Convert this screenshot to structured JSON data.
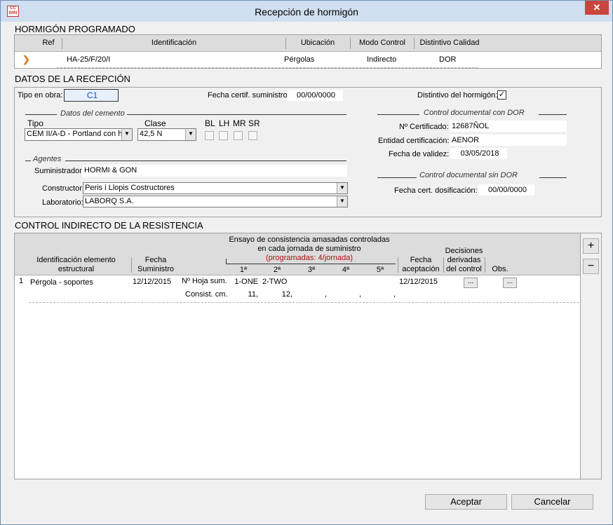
{
  "window": {
    "title": "Recepción de hormigón",
    "app_icon_text": "CC WIN",
    "close_label": "✕"
  },
  "programado": {
    "section_title": "HORMIGÓN PROGRAMADO",
    "columns": [
      "Ref",
      "Identificación",
      "Ubicación",
      "Modo Control",
      "Distintivo Calidad"
    ],
    "row": {
      "marker": "❯",
      "identificacion": "HA-25/F/20/I",
      "ubicacion": "Pérgolas",
      "modo_control": "Indirecto",
      "distintivo": "DOR"
    }
  },
  "recepcion": {
    "section_title": "DATOS DE LA RECEPCIÓN",
    "tipo_en_obra_label": "Tipo en obra:",
    "tipo_en_obra_value": "C1",
    "fecha_certif_label": "Fecha certif. suministro:",
    "fecha_certif_value": "00/00/0000",
    "distintivo_label": "Distintivo del hormigón:",
    "distintivo_checked": "✓",
    "cemento": {
      "group_title": "Datos del cemento",
      "tipo_label": "Tipo",
      "tipo_value": "CEM II/A-D - Portland con h",
      "clase_label": "Clase",
      "clase_value": "42,5 N",
      "flags": [
        "BL",
        "LH",
        "MR",
        "SR"
      ]
    },
    "agentes": {
      "group_title": "Agentes",
      "suministrador_label": "Suministrador:",
      "suministrador_value": "HORMI & GON",
      "constructor_label": "Constructor:",
      "constructor_value": "Peris i Llopis Costructores",
      "laboratorio_label": "Laboratorio:",
      "laboratorio_value": "LABORQ S.A."
    },
    "con_dor": {
      "group_title": "Control documental  con DOR",
      "certificado_label": "Nº Certificado:",
      "certificado_value": "12687ÑOL",
      "entidad_label": "Entidad certificación:",
      "entidad_value": "AENOR",
      "validez_label": "Fecha de validez:",
      "validez_value": "03/05/2018"
    },
    "sin_dor": {
      "group_title": "Control documental  sin DOR",
      "fecha_dosif_label": "Fecha cert. dosificación:",
      "fecha_dosif_value": "00/00/0000"
    }
  },
  "control": {
    "section_title": "CONTROL INDIRECTO DE LA RESISTENCIA",
    "headers": {
      "identificacion_1": "Identificación elemento",
      "identificacion_2": "estructural",
      "fecha_sum_1": "Fecha",
      "fecha_sum_2": "Suministro",
      "ensayo_1": "Ensayo de consistencia amasadas controladas",
      "ensayo_2": "en cada jornada de suministro",
      "programadas": "(programadas: 4/jornada)",
      "amasadas": [
        "1ª",
        "2ª",
        "3ª",
        "4ª",
        "5ª"
      ],
      "fecha_acep_1": "Fecha",
      "fecha_acep_2": "aceptación",
      "decisiones_1": "Decisiones",
      "decisiones_2": "derivadas",
      "decisiones_3": "del control",
      "obs": "Obs."
    },
    "row": {
      "num": "1",
      "elemento": "Pérgola - soportes",
      "fecha_suministro": "12/12/2015",
      "hoja_label": "Nº Hoja sum.",
      "consist_label": "Consist. cm.",
      "hojas": [
        "1-ONE",
        "2-TWO",
        "",
        "",
        ""
      ],
      "consist": [
        "11,",
        "12,",
        ",",
        ",",
        ","
      ],
      "fecha_aceptacion": "12/12/2015",
      "dots": "..."
    },
    "add_label": "+",
    "remove_label": "−"
  },
  "buttons": {
    "accept": "Aceptar",
    "cancel": "Cancelar"
  }
}
